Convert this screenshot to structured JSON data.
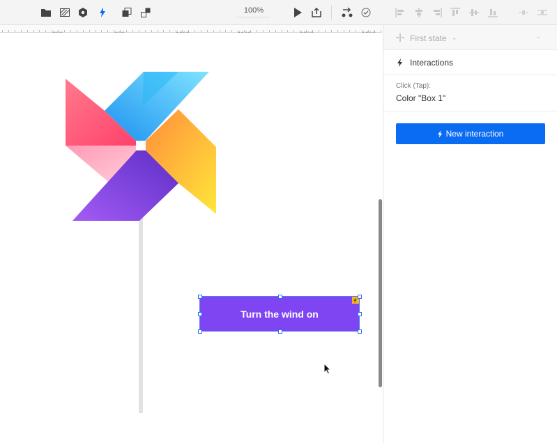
{
  "toolbar": {
    "zoom": "100%",
    "icons": [
      "folder-icon",
      "layers-icon",
      "component-icon",
      "interaction-bolt-icon",
      "duplicate-icon",
      "group-icon",
      "play-icon",
      "share-icon",
      "flow-icon",
      "check-circle-icon",
      "align-left-icon",
      "align-center-icon",
      "align-right-icon",
      "align-top-icon",
      "align-middle-icon",
      "align-bottom-icon",
      "distribute-h-icon",
      "distribute-v-icon"
    ]
  },
  "ruler": {
    "labels": [
      "800",
      "900",
      "1000",
      "1100",
      "1200",
      "1300"
    ]
  },
  "panel": {
    "state": "First state",
    "interactions_title": "Interactions",
    "trigger_type": "Click (Tap):",
    "trigger_action": "Color \"Box 1\"",
    "new_interaction": "New interaction"
  },
  "canvas": {
    "button_label": "Turn the wind on"
  },
  "colors": {
    "accent": "#0a6cf2",
    "button": "#7f45f2"
  }
}
